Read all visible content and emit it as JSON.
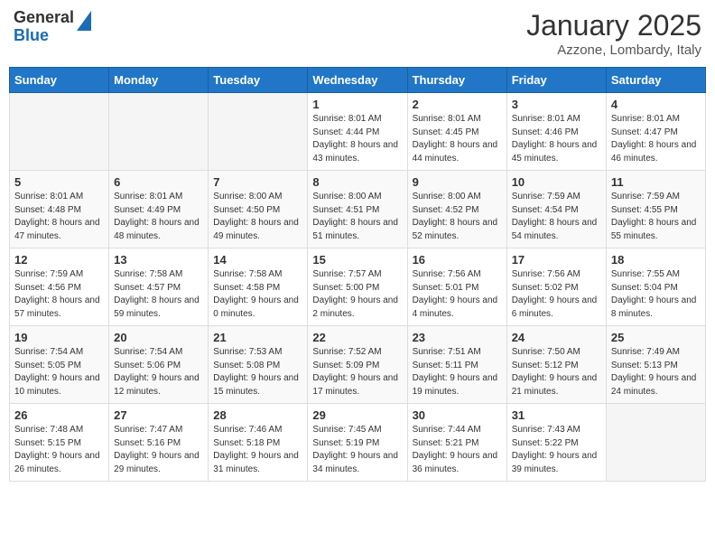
{
  "header": {
    "logo_general": "General",
    "logo_blue": "Blue",
    "month_title": "January 2025",
    "location": "Azzone, Lombardy, Italy"
  },
  "days_of_week": [
    "Sunday",
    "Monday",
    "Tuesday",
    "Wednesday",
    "Thursday",
    "Friday",
    "Saturday"
  ],
  "weeks": [
    [
      {
        "day": "",
        "info": ""
      },
      {
        "day": "",
        "info": ""
      },
      {
        "day": "",
        "info": ""
      },
      {
        "day": "1",
        "info": "Sunrise: 8:01 AM\nSunset: 4:44 PM\nDaylight: 8 hours and 43 minutes."
      },
      {
        "day": "2",
        "info": "Sunrise: 8:01 AM\nSunset: 4:45 PM\nDaylight: 8 hours and 44 minutes."
      },
      {
        "day": "3",
        "info": "Sunrise: 8:01 AM\nSunset: 4:46 PM\nDaylight: 8 hours and 45 minutes."
      },
      {
        "day": "4",
        "info": "Sunrise: 8:01 AM\nSunset: 4:47 PM\nDaylight: 8 hours and 46 minutes."
      }
    ],
    [
      {
        "day": "5",
        "info": "Sunrise: 8:01 AM\nSunset: 4:48 PM\nDaylight: 8 hours and 47 minutes."
      },
      {
        "day": "6",
        "info": "Sunrise: 8:01 AM\nSunset: 4:49 PM\nDaylight: 8 hours and 48 minutes."
      },
      {
        "day": "7",
        "info": "Sunrise: 8:00 AM\nSunset: 4:50 PM\nDaylight: 8 hours and 49 minutes."
      },
      {
        "day": "8",
        "info": "Sunrise: 8:00 AM\nSunset: 4:51 PM\nDaylight: 8 hours and 51 minutes."
      },
      {
        "day": "9",
        "info": "Sunrise: 8:00 AM\nSunset: 4:52 PM\nDaylight: 8 hours and 52 minutes."
      },
      {
        "day": "10",
        "info": "Sunrise: 7:59 AM\nSunset: 4:54 PM\nDaylight: 8 hours and 54 minutes."
      },
      {
        "day": "11",
        "info": "Sunrise: 7:59 AM\nSunset: 4:55 PM\nDaylight: 8 hours and 55 minutes."
      }
    ],
    [
      {
        "day": "12",
        "info": "Sunrise: 7:59 AM\nSunset: 4:56 PM\nDaylight: 8 hours and 57 minutes."
      },
      {
        "day": "13",
        "info": "Sunrise: 7:58 AM\nSunset: 4:57 PM\nDaylight: 8 hours and 59 minutes."
      },
      {
        "day": "14",
        "info": "Sunrise: 7:58 AM\nSunset: 4:58 PM\nDaylight: 9 hours and 0 minutes."
      },
      {
        "day": "15",
        "info": "Sunrise: 7:57 AM\nSunset: 5:00 PM\nDaylight: 9 hours and 2 minutes."
      },
      {
        "day": "16",
        "info": "Sunrise: 7:56 AM\nSunset: 5:01 PM\nDaylight: 9 hours and 4 minutes."
      },
      {
        "day": "17",
        "info": "Sunrise: 7:56 AM\nSunset: 5:02 PM\nDaylight: 9 hours and 6 minutes."
      },
      {
        "day": "18",
        "info": "Sunrise: 7:55 AM\nSunset: 5:04 PM\nDaylight: 9 hours and 8 minutes."
      }
    ],
    [
      {
        "day": "19",
        "info": "Sunrise: 7:54 AM\nSunset: 5:05 PM\nDaylight: 9 hours and 10 minutes."
      },
      {
        "day": "20",
        "info": "Sunrise: 7:54 AM\nSunset: 5:06 PM\nDaylight: 9 hours and 12 minutes."
      },
      {
        "day": "21",
        "info": "Sunrise: 7:53 AM\nSunset: 5:08 PM\nDaylight: 9 hours and 15 minutes."
      },
      {
        "day": "22",
        "info": "Sunrise: 7:52 AM\nSunset: 5:09 PM\nDaylight: 9 hours and 17 minutes."
      },
      {
        "day": "23",
        "info": "Sunrise: 7:51 AM\nSunset: 5:11 PM\nDaylight: 9 hours and 19 minutes."
      },
      {
        "day": "24",
        "info": "Sunrise: 7:50 AM\nSunset: 5:12 PM\nDaylight: 9 hours and 21 minutes."
      },
      {
        "day": "25",
        "info": "Sunrise: 7:49 AM\nSunset: 5:13 PM\nDaylight: 9 hours and 24 minutes."
      }
    ],
    [
      {
        "day": "26",
        "info": "Sunrise: 7:48 AM\nSunset: 5:15 PM\nDaylight: 9 hours and 26 minutes."
      },
      {
        "day": "27",
        "info": "Sunrise: 7:47 AM\nSunset: 5:16 PM\nDaylight: 9 hours and 29 minutes."
      },
      {
        "day": "28",
        "info": "Sunrise: 7:46 AM\nSunset: 5:18 PM\nDaylight: 9 hours and 31 minutes."
      },
      {
        "day": "29",
        "info": "Sunrise: 7:45 AM\nSunset: 5:19 PM\nDaylight: 9 hours and 34 minutes."
      },
      {
        "day": "30",
        "info": "Sunrise: 7:44 AM\nSunset: 5:21 PM\nDaylight: 9 hours and 36 minutes."
      },
      {
        "day": "31",
        "info": "Sunrise: 7:43 AM\nSunset: 5:22 PM\nDaylight: 9 hours and 39 minutes."
      },
      {
        "day": "",
        "info": ""
      }
    ]
  ]
}
